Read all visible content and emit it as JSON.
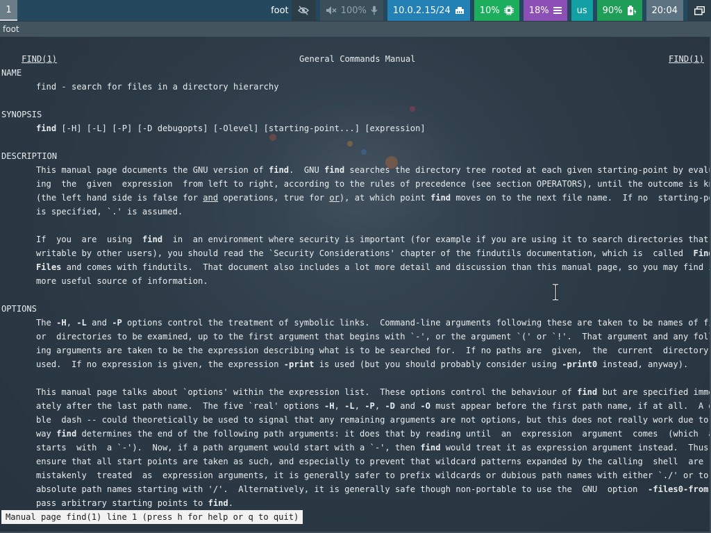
{
  "bar": {
    "workspace": "1",
    "window_title": "foot",
    "idle_icon": "eye-slash-icon",
    "audio": {
      "icon": "speaker-muted-icon",
      "value": "100%",
      "mic_icon": "microphone-icon"
    },
    "network": {
      "value": "10.0.2.15/24",
      "icon": "ethernet-icon"
    },
    "cpu": {
      "value": "10%",
      "icon": "cpu-chip-icon"
    },
    "memory": {
      "value": "18%",
      "icon": "memory-bars-icon"
    },
    "language": {
      "value": "us"
    },
    "battery": {
      "value": "90%",
      "icon": "battery-charging-icon"
    },
    "clock": {
      "value": "20:04"
    },
    "system_icon": "window-switcher-icon"
  },
  "terminal": {
    "title": "foot",
    "header": {
      "left": "FIND(1)",
      "center": "General Commands Manual",
      "right": "FIND(1)"
    },
    "sections": {
      "name_heading": "NAME",
      "name_text": "find - search for files in a directory hierarchy",
      "synopsis_heading": "SYNOPSIS",
      "synopsis_cmd": "find",
      "synopsis_args": " [-H] [-L] [-P] [-D debugopts] [-Olevel] [starting-point...] [expression]",
      "description_heading": "DESCRIPTION",
      "options_heading": "OPTIONS"
    },
    "status_line": "Manual page find(1) line 1 (press h for help or q to quit)"
  }
}
